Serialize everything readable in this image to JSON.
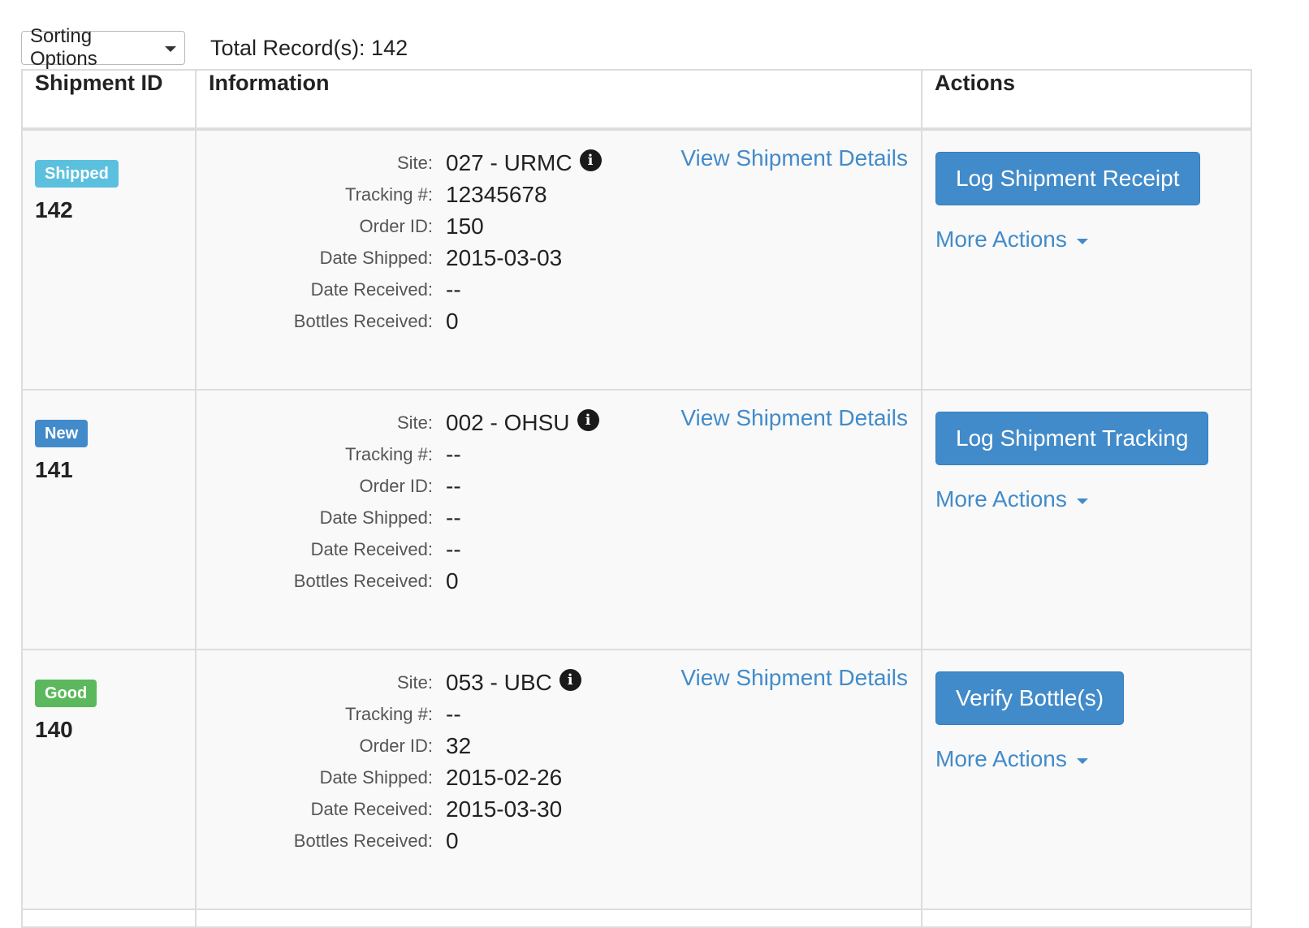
{
  "toolbar": {
    "sort_label": "Sorting Options",
    "total_label": "Total Record(s): 142"
  },
  "table": {
    "headers": [
      "Shipment ID",
      "Information",
      "Actions"
    ],
    "labels": {
      "site": "Site:",
      "tracking": "Tracking #:",
      "order": "Order ID:",
      "shipped": "Date Shipped:",
      "received": "Date Received:",
      "bottles": "Bottles Received:"
    },
    "rows": [
      {
        "status": "Shipped",
        "status_color": "#5bc0de",
        "id": "142",
        "site": "027 - URMC",
        "tracking": "12345678",
        "order": "150",
        "shipped": "2015-03-03",
        "received": "--",
        "bottles": "0",
        "view_link": "View Shipment Details",
        "action": "Log Shipment Receipt",
        "more": "More Actions"
      },
      {
        "status": "New",
        "status_color": "#428bca",
        "id": "141",
        "site": "002 - OHSU",
        "tracking": "--",
        "order": "--",
        "shipped": "--",
        "received": "--",
        "bottles": "0",
        "view_link": "View Shipment Details",
        "action": "Log Shipment Tracking",
        "more": "More Actions"
      },
      {
        "status": "Good",
        "status_color": "#5cb85c",
        "id": "140",
        "site": "053 - UBC",
        "tracking": "--",
        "order": "32",
        "shipped": "2015-02-26",
        "received": "2015-03-30",
        "bottles": "0",
        "view_link": "View Shipment Details",
        "action": "Verify Bottle(s)",
        "more": "More Actions"
      }
    ]
  },
  "icons": {
    "info": "info-circle-icon",
    "caret": "caret-down-icon"
  },
  "colors": {
    "link": "#428bca",
    "button": "#428bca"
  }
}
